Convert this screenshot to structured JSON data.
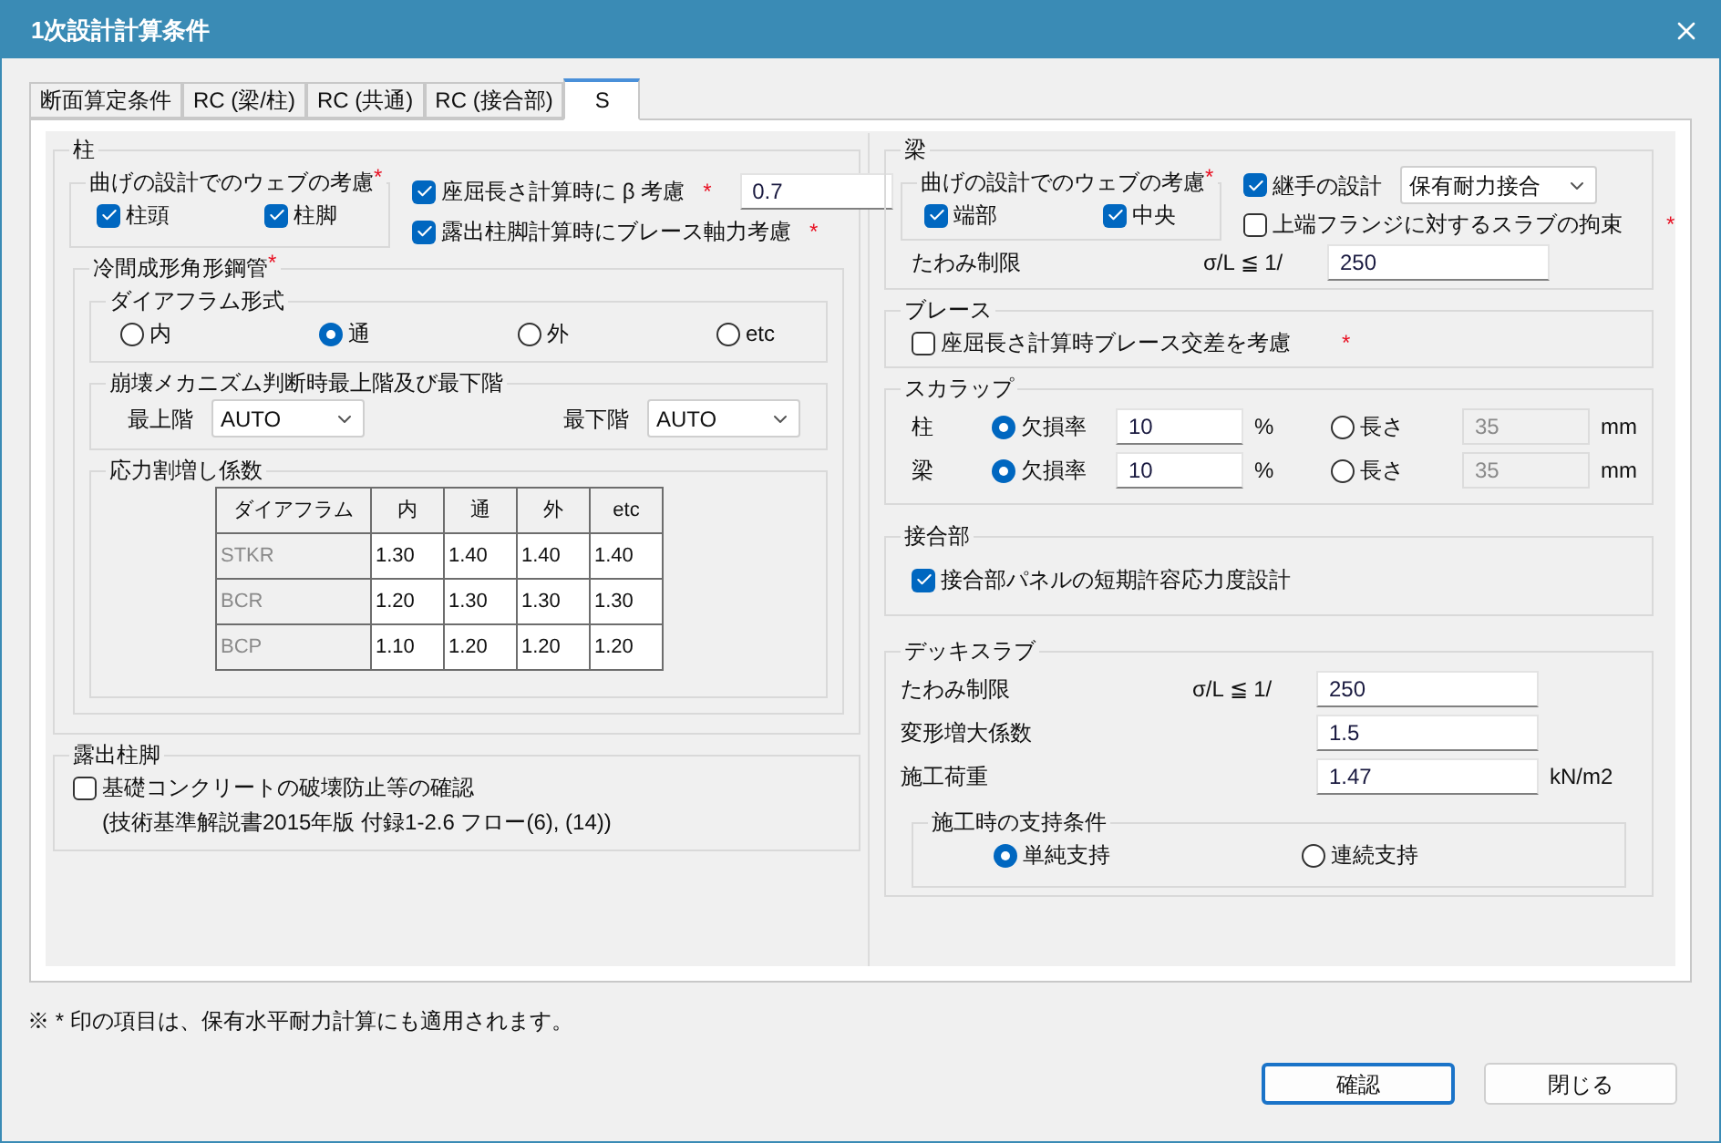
{
  "window": {
    "title": "1次設計計算条件"
  },
  "tabs": [
    {
      "label": "断面算定条件",
      "selected": false
    },
    {
      "label": "RC (梁/柱)",
      "selected": false
    },
    {
      "label": "RC (共通)",
      "selected": false
    },
    {
      "label": "RC (接合部)",
      "selected": false
    },
    {
      "label": "S",
      "selected": true
    }
  ],
  "column": {
    "title": "柱",
    "web": {
      "title": "曲げの設計でのウェブの考慮",
      "mark": "*",
      "checks": [
        {
          "label": "柱頭",
          "checked": true
        },
        {
          "label": "柱脚",
          "checked": true
        }
      ]
    },
    "options": [
      {
        "label": "座屈長さ計算時に β 考慮",
        "checked": true,
        "mark": "*",
        "value": "0.7"
      },
      {
        "label": "露出柱脚計算時にブレース軸力考慮",
        "checked": true,
        "mark": "*"
      }
    ],
    "cold_formed": {
      "title": "冷間成形角形鋼管",
      "mark": "*",
      "diaphragm": {
        "title": "ダイアフラム形式",
        "options": [
          {
            "label": "内",
            "selected": false
          },
          {
            "label": "通",
            "selected": true
          },
          {
            "label": "外",
            "selected": false
          },
          {
            "label": "etc",
            "selected": false
          }
        ]
      },
      "floors": {
        "title": "崩壊メカニズム判断時最上階及び最下階",
        "fields": [
          {
            "label": "最上階",
            "value": "AUTO"
          },
          {
            "label": "最下階",
            "value": "AUTO"
          }
        ]
      },
      "factors": {
        "title": "応力割増し係数",
        "columns": [
          "ダイアフラム",
          "内",
          "通",
          "外",
          "etc"
        ],
        "rows": [
          [
            "STKR",
            "1.30",
            "1.40",
            "1.40",
            "1.40"
          ],
          [
            "BCR",
            "1.20",
            "1.30",
            "1.30",
            "1.30"
          ],
          [
            "BCP",
            "1.10",
            "1.20",
            "1.20",
            "1.20"
          ]
        ]
      }
    },
    "exposed_base": {
      "title": "露出柱脚",
      "check": {
        "label": "基礎コンクリートの破壊防止等の確認",
        "checked": false
      },
      "note": "(技術基準解説書2015年版 付録1-2.6 フロー(6), (14))"
    }
  },
  "beam": {
    "title": "梁",
    "web": {
      "title": "曲げの設計でのウェブの考慮",
      "mark": "*",
      "checks": [
        {
          "label": "端部",
          "checked": true
        },
        {
          "label": "中央",
          "checked": true
        }
      ]
    },
    "joint": {
      "label": "継手の設計",
      "checked": true,
      "value": "保有耐力接合"
    },
    "flange": {
      "label": "上端フランジに対するスラブの拘束",
      "checked": false,
      "mark": "*"
    },
    "deflection": {
      "label": "たわみ制限",
      "formula": "σ/L ≦ 1/",
      "value": "250"
    }
  },
  "brace": {
    "title": "ブレース",
    "check": {
      "label": "座屈長さ計算時ブレース交差を考慮",
      "checked": false,
      "mark": "*"
    }
  },
  "scallop": {
    "title": "スカラップ",
    "rows": [
      {
        "label": "柱",
        "options": [
          {
            "label": "欠損率",
            "selected": true,
            "value": "10",
            "unit": "%",
            "disabled": false
          },
          {
            "label": "長さ",
            "selected": false,
            "value": "35",
            "unit": "mm",
            "disabled": true
          }
        ]
      },
      {
        "label": "梁",
        "options": [
          {
            "label": "欠損率",
            "selected": true,
            "value": "10",
            "unit": "%",
            "disabled": false
          },
          {
            "label": "長さ",
            "selected": false,
            "value": "35",
            "unit": "mm",
            "disabled": true
          }
        ]
      }
    ]
  },
  "joint": {
    "title": "接合部",
    "check": {
      "label": "接合部パネルの短期許容応力度設計",
      "checked": true
    }
  },
  "deck": {
    "title": "デッキスラブ",
    "rows": [
      {
        "label": "たわみ制限",
        "formula": "σ/L ≦ 1/",
        "value": "250"
      },
      {
        "label": "変形増大係数",
        "value": "1.5"
      },
      {
        "label": "施工荷重",
        "value": "1.47",
        "unit": "kN/m2"
      }
    ],
    "support": {
      "title": "施工時の支持条件",
      "options": [
        {
          "label": "単純支持",
          "selected": true
        },
        {
          "label": "連続支持",
          "selected": false
        }
      ]
    }
  },
  "footnote": "※ * 印の項目は、保有水平耐力計算にも適用されます。",
  "buttons": [
    {
      "label": "確認",
      "default": true
    },
    {
      "label": "閉じる",
      "default": false
    }
  ]
}
